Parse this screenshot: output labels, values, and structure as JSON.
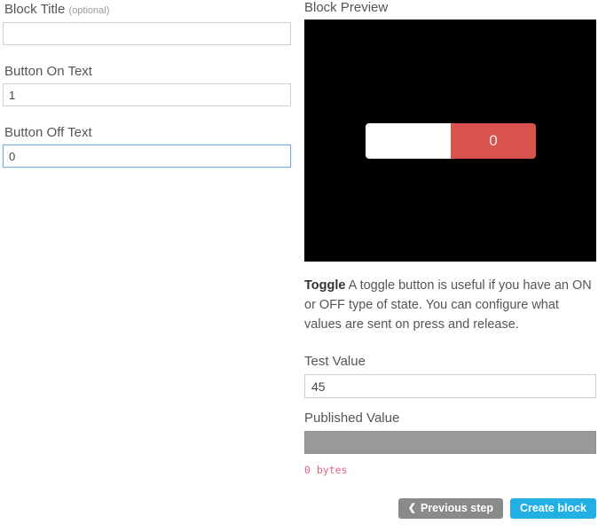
{
  "left_panel": {
    "fields": [
      {
        "label": "Block Title",
        "suffix": "(optional)",
        "value": "",
        "placeholder": ""
      },
      {
        "label": "Button On Text",
        "value": "1",
        "placeholder": ""
      },
      {
        "label": "Button Off Text",
        "value": "0",
        "placeholder": ""
      }
    ]
  },
  "right_panel": {
    "preview_title": "Block Preview",
    "preview": {
      "background_color": "#000000",
      "toggle": {
        "off_text": "",
        "on_text": "0",
        "on_color": "#d9534f",
        "off_color": "#ffffff"
      }
    },
    "description": {
      "name": "Toggle",
      "text": " A toggle button is useful if you have an ON or OFF type of state. You can configure what values are sent on press and release."
    },
    "test_value": {
      "label": "Test Value",
      "value": "45",
      "placeholder": ""
    },
    "published_value": {
      "label": "Published Value",
      "value": "",
      "bar_color": "#999999",
      "bytes_text": "0 bytes",
      "bytes_color": "#e8607e"
    }
  },
  "footer": {
    "previous_label": "Previous step",
    "previous_icon": "chevron-left-icon",
    "create_label": "Create block",
    "primary_color": "#22b0e4",
    "secondary_color": "#8a8a8a"
  }
}
